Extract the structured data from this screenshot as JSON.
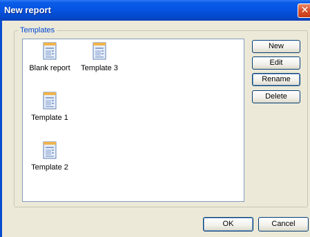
{
  "window": {
    "title": "New report",
    "close_glyph": "✕"
  },
  "templates_group": {
    "label": "Templates",
    "items": [
      {
        "label": "Blank report",
        "icon": "document-icon"
      },
      {
        "label": "Template 3",
        "icon": "document-icon"
      },
      {
        "label": "Template 1",
        "icon": "document-icon"
      },
      {
        "label": "Template 2",
        "icon": "document-icon"
      }
    ]
  },
  "side_buttons": {
    "new": "New",
    "edit": "Edit",
    "rename": "Rename",
    "delete": "Delete"
  },
  "footer": {
    "ok": "OK",
    "cancel": "Cancel"
  },
  "colors": {
    "titlebar": "#0553e0",
    "group_label": "#0046d5",
    "close": "#d9502a"
  }
}
